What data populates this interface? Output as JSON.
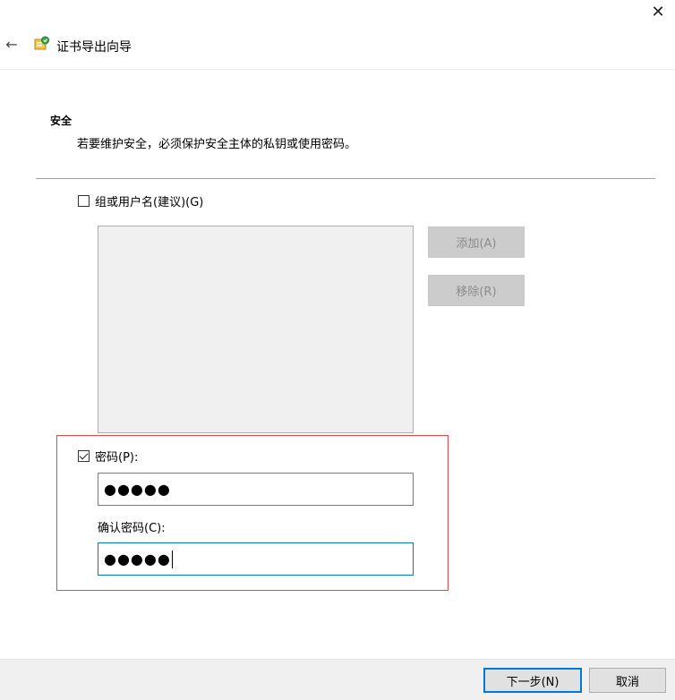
{
  "window": {
    "title": "证书导出向导",
    "close_glyph": "✕",
    "back_glyph": "←"
  },
  "section": {
    "title": "安全",
    "description": "若要维护安全，必须保护安全主体的私钥或使用密码。"
  },
  "group_option": {
    "label": "组或用户名(建议)(G)",
    "checked": false,
    "add_label": "添加(A)",
    "remove_label": "移除(R)"
  },
  "password_option": {
    "label": "密码(P):",
    "checked": true,
    "password_value": "●●●●●",
    "confirm_label": "确认密码(C):",
    "confirm_value": "●●●●●"
  },
  "footer": {
    "next_label": "下一步(N)",
    "cancel_label": "取消"
  },
  "colors": {
    "accent": "#0078d7",
    "highlight": "#e0484a"
  },
  "icons": {
    "close": "close-icon",
    "back": "back-arrow-icon",
    "wizard": "certificate-wizard-icon"
  }
}
